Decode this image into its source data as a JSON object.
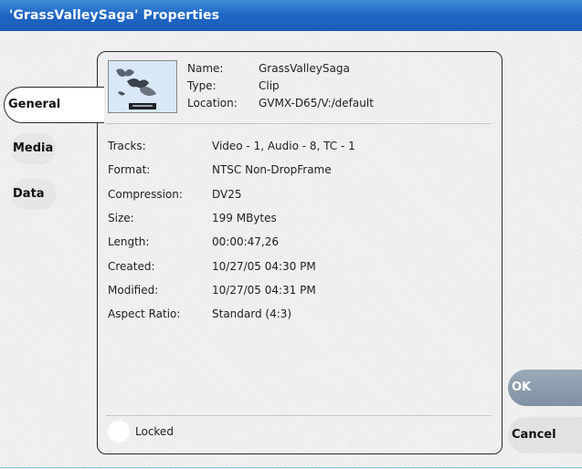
{
  "window": {
    "title": "'GrassValleySaga' Properties"
  },
  "tabs": [
    {
      "label": "General",
      "selected": true
    },
    {
      "label": "Media",
      "selected": false
    },
    {
      "label": "Data",
      "selected": false
    }
  ],
  "header": {
    "name_label": "Name:",
    "name_value": "GrassValleySaga",
    "type_label": "Type:",
    "type_value": "Clip",
    "location_label": "Location:",
    "location_value": "GVMX-D65/V:/default"
  },
  "properties": [
    {
      "label": "Tracks:",
      "value": "Video - 1, Audio - 8, TC - 1"
    },
    {
      "label": "Format:",
      "value": "NTSC Non-DropFrame"
    },
    {
      "label": "Compression:",
      "value": "DV25"
    },
    {
      "label": "Size:",
      "value": "199 MBytes"
    },
    {
      "label": "Length:",
      "value": "00:00:47,26"
    },
    {
      "label": "Created:",
      "value": "10/27/05 04:30 PM"
    },
    {
      "label": "Modified:",
      "value": "10/27/05 04:31 PM"
    },
    {
      "label": "Aspect Ratio:",
      "value": "Standard (4:3)"
    }
  ],
  "locked": {
    "label": "Locked",
    "checked": false
  },
  "buttons": {
    "ok": "OK",
    "cancel": "Cancel"
  },
  "colors": {
    "titlebar": "#1f66c4",
    "ok_button": "#8c9db0",
    "border": "#2a2a2a"
  }
}
